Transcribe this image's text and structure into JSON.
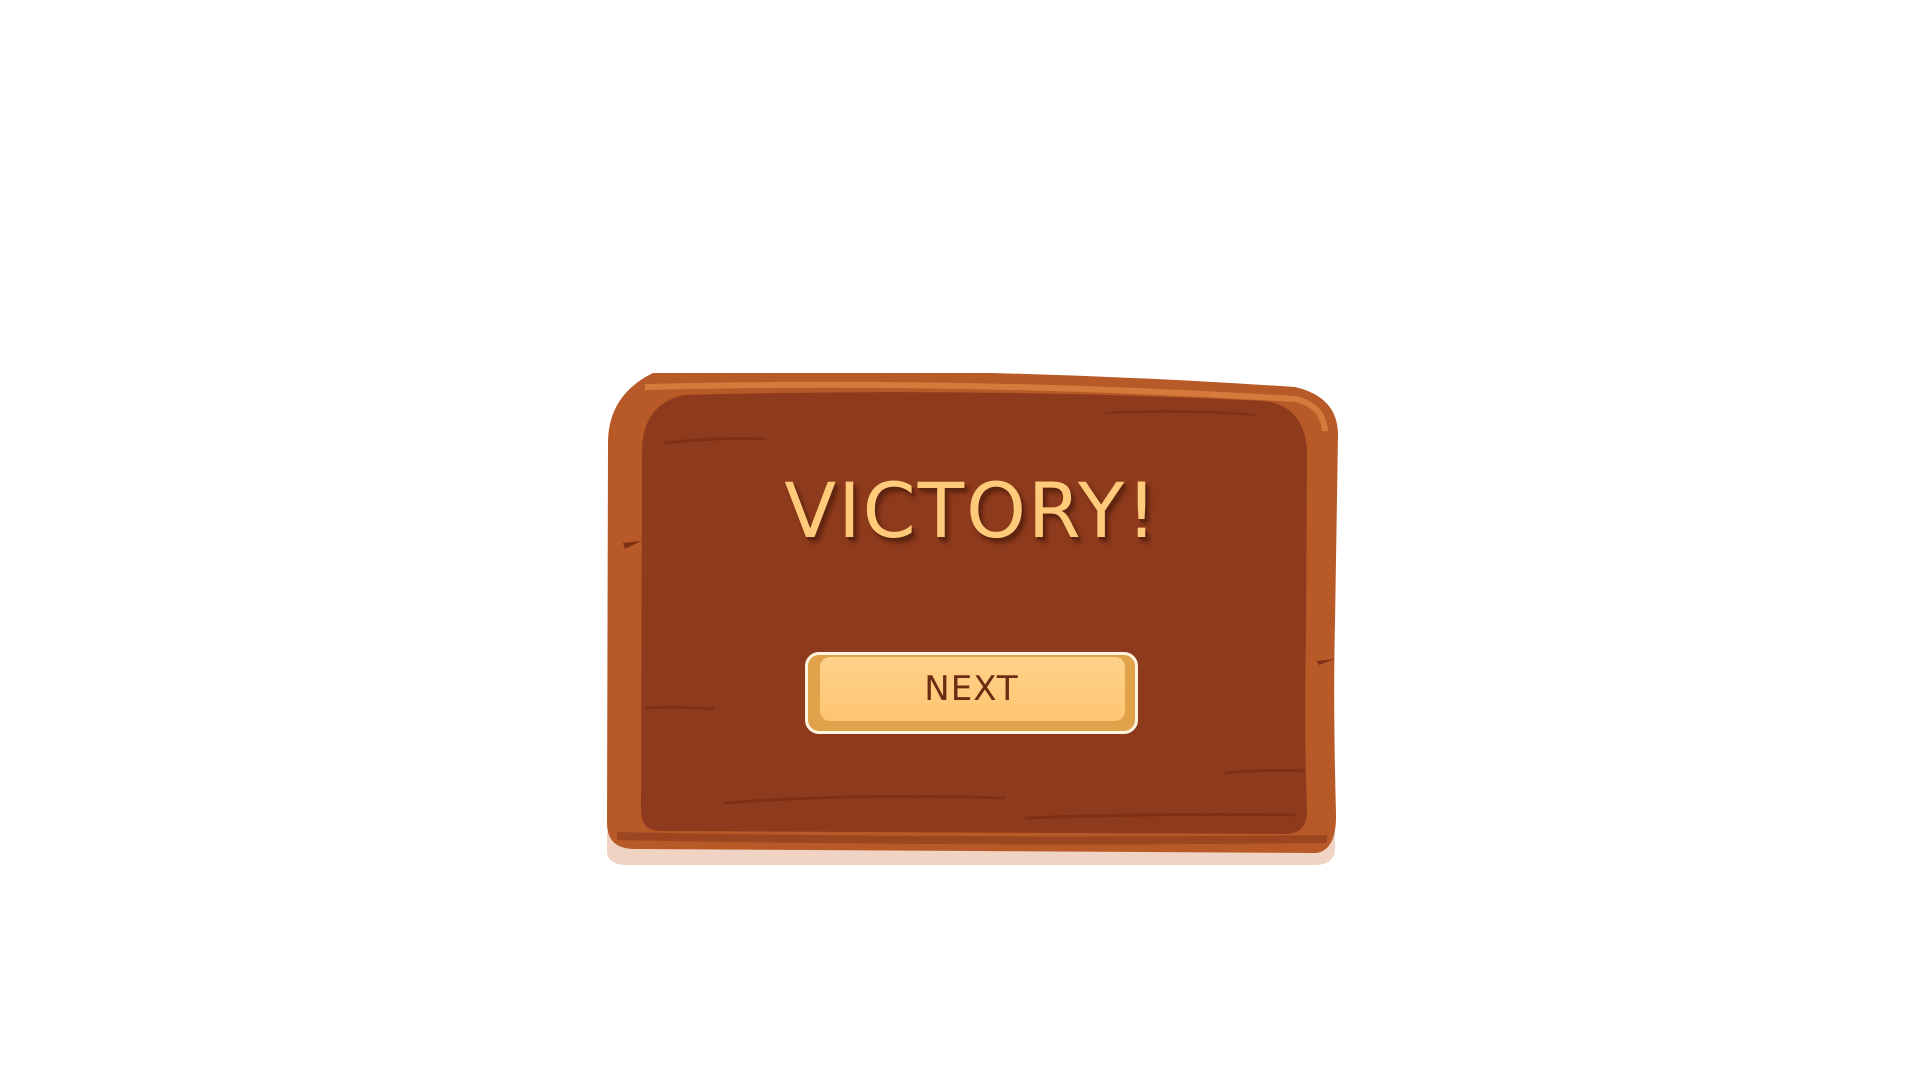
{
  "screen": {
    "title": "VICTORY!"
  },
  "actions": {
    "next_label": "NEXT"
  },
  "colors": {
    "board_dark": "#8e3a1c",
    "board_frame": "#b85a28",
    "board_rim": "#d57a3c",
    "title_text": "#ffcb7a",
    "button_face": "#fec572",
    "button_text": "#6b2c12"
  },
  "icons": {
    "board": "wooden-board-panel"
  }
}
